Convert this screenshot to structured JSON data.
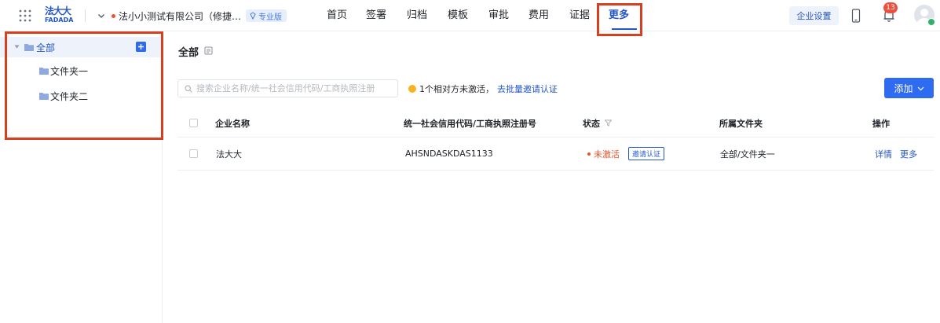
{
  "header": {
    "logo_text": "法大大",
    "logo_subtext": "FADADA",
    "company_name": "法小小测试有限公司（修捷…",
    "company_badge": "专业版",
    "nav": [
      {
        "label": "首页"
      },
      {
        "label": "签署"
      },
      {
        "label": "归档"
      },
      {
        "label": "模板"
      },
      {
        "label": "审批"
      },
      {
        "label": "费用"
      },
      {
        "label": "证据"
      },
      {
        "label": "更多",
        "active": true
      }
    ],
    "settings_label": "企业设置",
    "notification_count": "13",
    "icons": [
      "grid-icon",
      "chevron-down-icon",
      "diamond-icon",
      "phone-icon",
      "bell-icon",
      "avatar",
      "check-icon"
    ],
    "accent_color": "#2356c6",
    "highlight_color": "#d6401f"
  },
  "sidebar": {
    "root_label": "全部",
    "children": [
      {
        "label": "文件夹一"
      },
      {
        "label": "文件夹二"
      }
    ],
    "icons": [
      "caret-down-icon",
      "folder-icon",
      "add-icon"
    ]
  },
  "main": {
    "title": "全部",
    "search_placeholder": "搜索企业名称/统一社会信用代码/工商执照注册",
    "notice_text": "1个相对方未激活，",
    "notice_link": "去批量邀请认证",
    "add_button": "添加",
    "table": {
      "columns": [
        "企业名称",
        "统一社会信用代码/工商执照注册号",
        "状态",
        "所属文件夹",
        "操作"
      ],
      "rows": [
        {
          "name": "法大大",
          "code": "AHSNDASKDAS1133",
          "status": "未激活",
          "status_action": "邀请认证",
          "folder": "全部/文件夹一",
          "actions": [
            "详情",
            "更多"
          ]
        }
      ]
    }
  }
}
